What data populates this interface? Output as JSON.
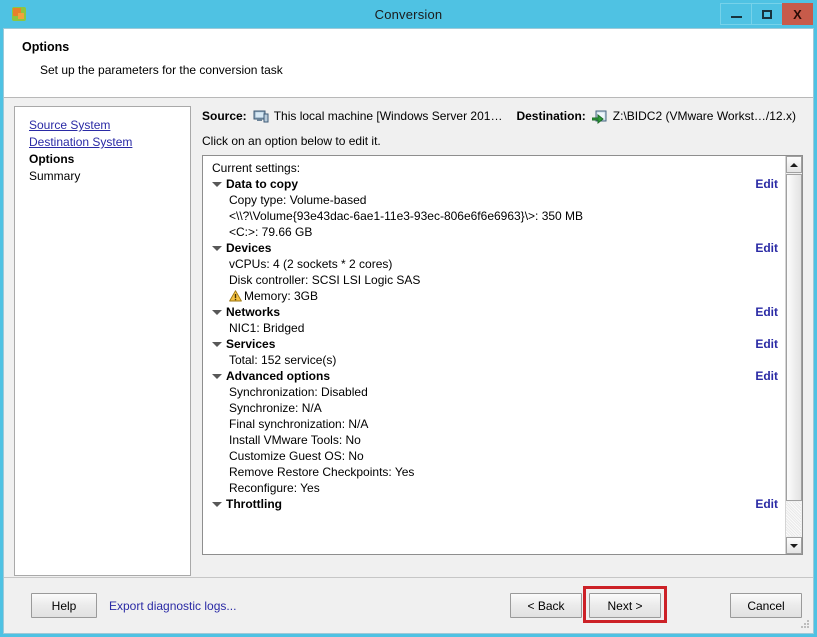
{
  "window": {
    "title": "Conversion",
    "app_icon": "converter-icon",
    "minimize_label": "Minimize",
    "maximize_label": "Maximize",
    "close_label": "X",
    "border_color": "#4fc2e3",
    "close_color": "#c75b4a"
  },
  "header": {
    "title": "Options",
    "subtitle": "Set up the parameters for the conversion task"
  },
  "sidebar": {
    "items": [
      {
        "label": "Source System",
        "state": "link"
      },
      {
        "label": "Destination System",
        "state": "link"
      },
      {
        "label": "Options",
        "state": "current"
      },
      {
        "label": "Summary",
        "state": "normal"
      }
    ]
  },
  "source_dest": {
    "source_label": "Source:",
    "source_icon": "computer-icon",
    "source_value": "This local machine [Windows Server 201…",
    "destination_label": "Destination:",
    "destination_icon": "vm-export-icon",
    "destination_value": "Z:\\BIDC2 (VMware Workst…/12.x)"
  },
  "hint": "Click on an option below to edit it.",
  "settings": {
    "caption": "Current settings:",
    "edit_label": "Edit",
    "rows": [
      {
        "type": "plain",
        "text": "Current settings:",
        "edit": false
      },
      {
        "type": "group",
        "text": "Data to copy",
        "edit": true
      },
      {
        "type": "child",
        "text": "Copy type: Volume-based",
        "edit": false
      },
      {
        "type": "child",
        "text": "<\\\\?\\Volume{93e43dac-6ae1-11e3-93ec-806e6f6e6963}\\>: 350 MB",
        "edit": false
      },
      {
        "type": "child",
        "text": "<C:>: 79.66 GB",
        "edit": false
      },
      {
        "type": "group",
        "text": "Devices",
        "edit": true
      },
      {
        "type": "child",
        "text": "vCPUs: 4 (2 sockets * 2 cores)",
        "edit": false
      },
      {
        "type": "child",
        "text": "Disk controller: SCSI LSI Logic SAS",
        "edit": false
      },
      {
        "type": "child",
        "text": "Memory: 3GB",
        "edit": false,
        "warning": true
      },
      {
        "type": "group",
        "text": "Networks",
        "edit": true
      },
      {
        "type": "child",
        "text": "NIC1: Bridged",
        "edit": false
      },
      {
        "type": "group",
        "text": "Services",
        "edit": true
      },
      {
        "type": "child",
        "text": "Total: 152 service(s)",
        "edit": false
      },
      {
        "type": "group",
        "text": "Advanced options",
        "edit": true
      },
      {
        "type": "child",
        "text": "Synchronization: Disabled",
        "edit": false
      },
      {
        "type": "child",
        "text": "Synchronize: N/A",
        "edit": false
      },
      {
        "type": "child",
        "text": "Final synchronization: N/A",
        "edit": false
      },
      {
        "type": "child",
        "text": "Install VMware Tools: No",
        "edit": false
      },
      {
        "type": "child",
        "text": "Customize Guest OS: No",
        "edit": false
      },
      {
        "type": "child",
        "text": "Remove Restore Checkpoints: Yes",
        "edit": false
      },
      {
        "type": "child",
        "text": "Reconfigure: Yes",
        "edit": false
      },
      {
        "type": "group",
        "text": "Throttling",
        "edit": true
      }
    ]
  },
  "footer": {
    "help_label": "Help",
    "export_logs_label": "Export diagnostic logs...",
    "back_label": "< Back",
    "next_label": "Next >",
    "cancel_label": "Cancel",
    "highlight_color": "#cc2127",
    "highlighted_button": "Next >"
  }
}
